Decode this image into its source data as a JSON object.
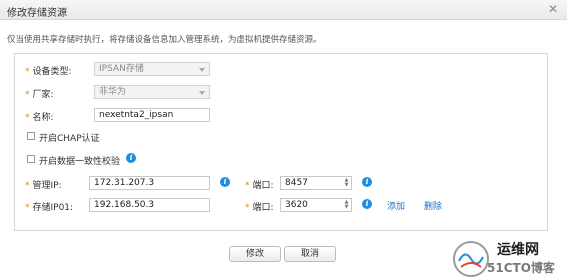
{
  "dialog": {
    "title": "修改存储资源",
    "close_glyph": "✕"
  },
  "description": "仅当使用共享存储时执行，将存储设备信息加入管理系统，为虚拟机提供存储资源。",
  "required_mark": "*",
  "form": {
    "device_type": {
      "label": "设备类型:",
      "value": "IPSAN存储"
    },
    "vendor": {
      "label": "厂家:",
      "value": "非华为"
    },
    "name": {
      "label": "名称:",
      "value": "nexetnta2_ipsan"
    },
    "chap": {
      "label": "开启CHAP认证",
      "checked": false
    },
    "consistency": {
      "label": "开启数据一致性校验",
      "checked": false
    },
    "mgmt_ip": {
      "label": "管理IP:",
      "value": "172.31.207.3"
    },
    "mgmt_port": {
      "label": "端口:",
      "value": "8457"
    },
    "storage_ip": {
      "label": "存储IP01:",
      "value": "192.168.50.3"
    },
    "storage_port": {
      "label": "端口:",
      "value": "3620"
    },
    "add_link": "添加",
    "delete_link": "删除"
  },
  "buttons": {
    "ok": "修改",
    "cancel": "取消"
  },
  "watermark": {
    "line1": "运维网",
    "line2": "51CTO博客"
  },
  "colors": {
    "accent_blue": "#1a8fe3",
    "link": "#1a73c8",
    "required": "#e08a00"
  }
}
